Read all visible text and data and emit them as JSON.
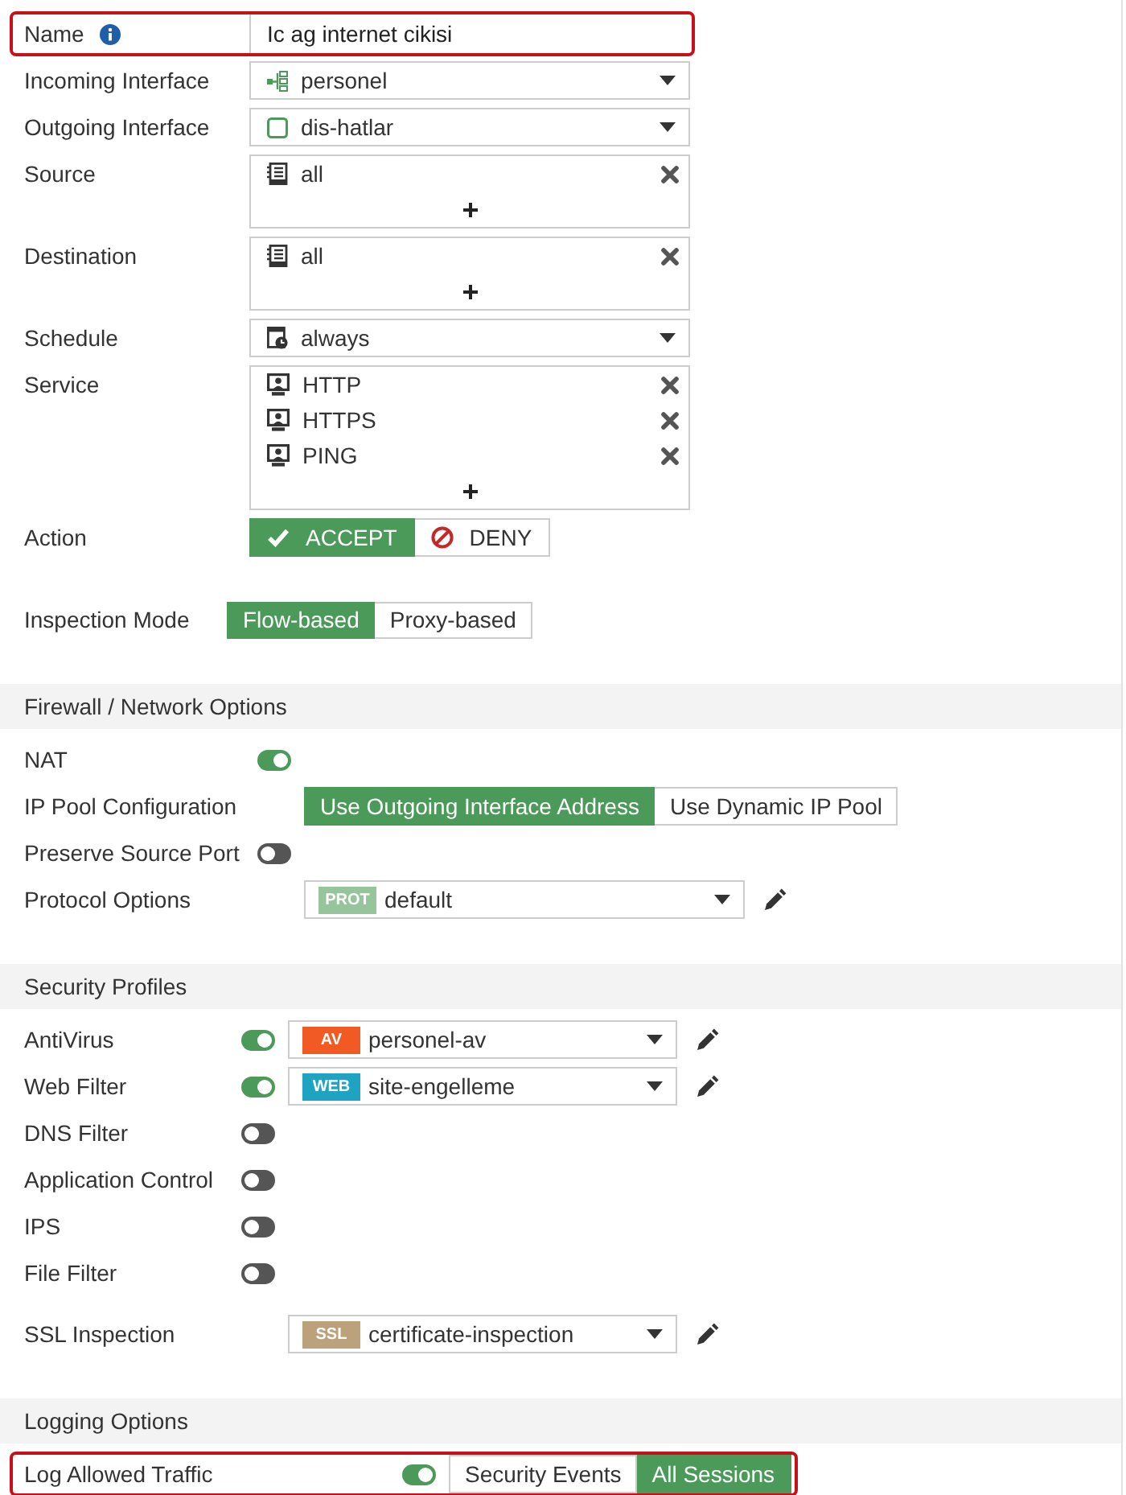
{
  "fields": [
    {
      "kind": "text",
      "label": "Name",
      "info": true,
      "highlighted": true,
      "value": "Ic ag internet cikisi"
    },
    {
      "kind": "select",
      "label": "Incoming Interface",
      "highlighted": false,
      "entry": {
        "kind": "zone",
        "text": "personel"
      }
    },
    {
      "kind": "select",
      "label": "Outgoing Interface",
      "highlighted": false,
      "entry": {
        "kind": "port",
        "text": "dis-hatlar"
      }
    },
    {
      "kind": "multi",
      "label": "Source",
      "highlighted": false,
      "entries": [
        {
          "kind": "address",
          "text": "all"
        }
      ]
    },
    {
      "kind": "multi",
      "label": "Destination",
      "highlighted": false,
      "entries": [
        {
          "kind": "address",
          "text": "all"
        }
      ]
    },
    {
      "kind": "select",
      "label": "Schedule",
      "highlighted": false,
      "entry": {
        "kind": "schedule",
        "text": "always"
      }
    },
    {
      "kind": "multi",
      "label": "Service",
      "highlighted": false,
      "entries": [
        {
          "kind": "service",
          "text": "HTTP"
        },
        {
          "kind": "service",
          "text": "HTTPS"
        },
        {
          "kind": "service",
          "text": "PING"
        }
      ]
    },
    {
      "kind": "choice",
      "label": "Action",
      "highlighted": false,
      "options": [
        {
          "kind": "accept",
          "text": "ACCEPT",
          "selected": true
        },
        {
          "kind": "deny",
          "text": "DENY",
          "selected": false
        }
      ]
    }
  ],
  "inspection_mode": {
    "label": "Inspection Mode",
    "options": [
      {
        "text": "Flow-based",
        "selected": true
      },
      {
        "text": "Proxy-based",
        "selected": false
      }
    ]
  },
  "sections": [
    {
      "title": "Firewall / Network Options",
      "groups": [
        {
          "rows": [
            {
              "kind": "toggle",
              "label": "NAT",
              "on": true,
              "highlighted": false
            },
            {
              "kind": "choice",
              "label": "IP Pool Configuration",
              "highlighted": false,
              "options": [
                {
                  "text": "Use Outgoing Interface Address",
                  "selected": true
                },
                {
                  "text": "Use Dynamic IP Pool",
                  "selected": false
                }
              ]
            },
            {
              "kind": "toggle",
              "label": "Preserve Source Port",
              "on": false,
              "highlighted": false
            },
            {
              "kind": "profile",
              "label": "Protocol Options",
              "highlighted": false,
              "profile": {
                "tag": "PROT",
                "color": "#96c59b",
                "value": "default"
              }
            }
          ]
        }
      ]
    },
    {
      "title": "Security Profiles",
      "groups": [
        {
          "rows": [
            {
              "kind": "profile",
              "label": "AntiVirus",
              "on": true,
              "highlighted": false,
              "profile": {
                "tag": "AV",
                "color": "#f15a22",
                "value": "personel-av"
              }
            },
            {
              "kind": "profile",
              "label": "Web Filter",
              "on": true,
              "highlighted": false,
              "profile": {
                "tag": "WEB",
                "color": "#1fa3c2",
                "value": "site-engelleme"
              }
            },
            {
              "kind": "toggle",
              "label": "DNS Filter",
              "on": false,
              "highlighted": false
            },
            {
              "kind": "toggle",
              "label": "Application Control",
              "on": false,
              "highlighted": false
            },
            {
              "kind": "toggle",
              "label": "IPS",
              "on": false,
              "highlighted": false
            },
            {
              "kind": "toggle",
              "label": "File Filter",
              "on": false,
              "highlighted": false
            }
          ]
        },
        {
          "rows": [
            {
              "kind": "profile",
              "label": "SSL Inspection",
              "highlighted": false,
              "profile": {
                "tag": "SSL",
                "color": "#bba27a",
                "value": "certificate-inspection"
              }
            }
          ]
        }
      ]
    },
    {
      "title": "Logging Options",
      "groups": [
        {
          "rows": [
            {
              "kind": "toggle-choice",
              "label": "Log Allowed Traffic",
              "on": true,
              "highlighted": true,
              "options": [
                {
                  "text": "Security Events",
                  "selected": false
                },
                {
                  "text": "All Sessions",
                  "selected": true
                }
              ]
            }
          ]
        }
      ]
    }
  ]
}
